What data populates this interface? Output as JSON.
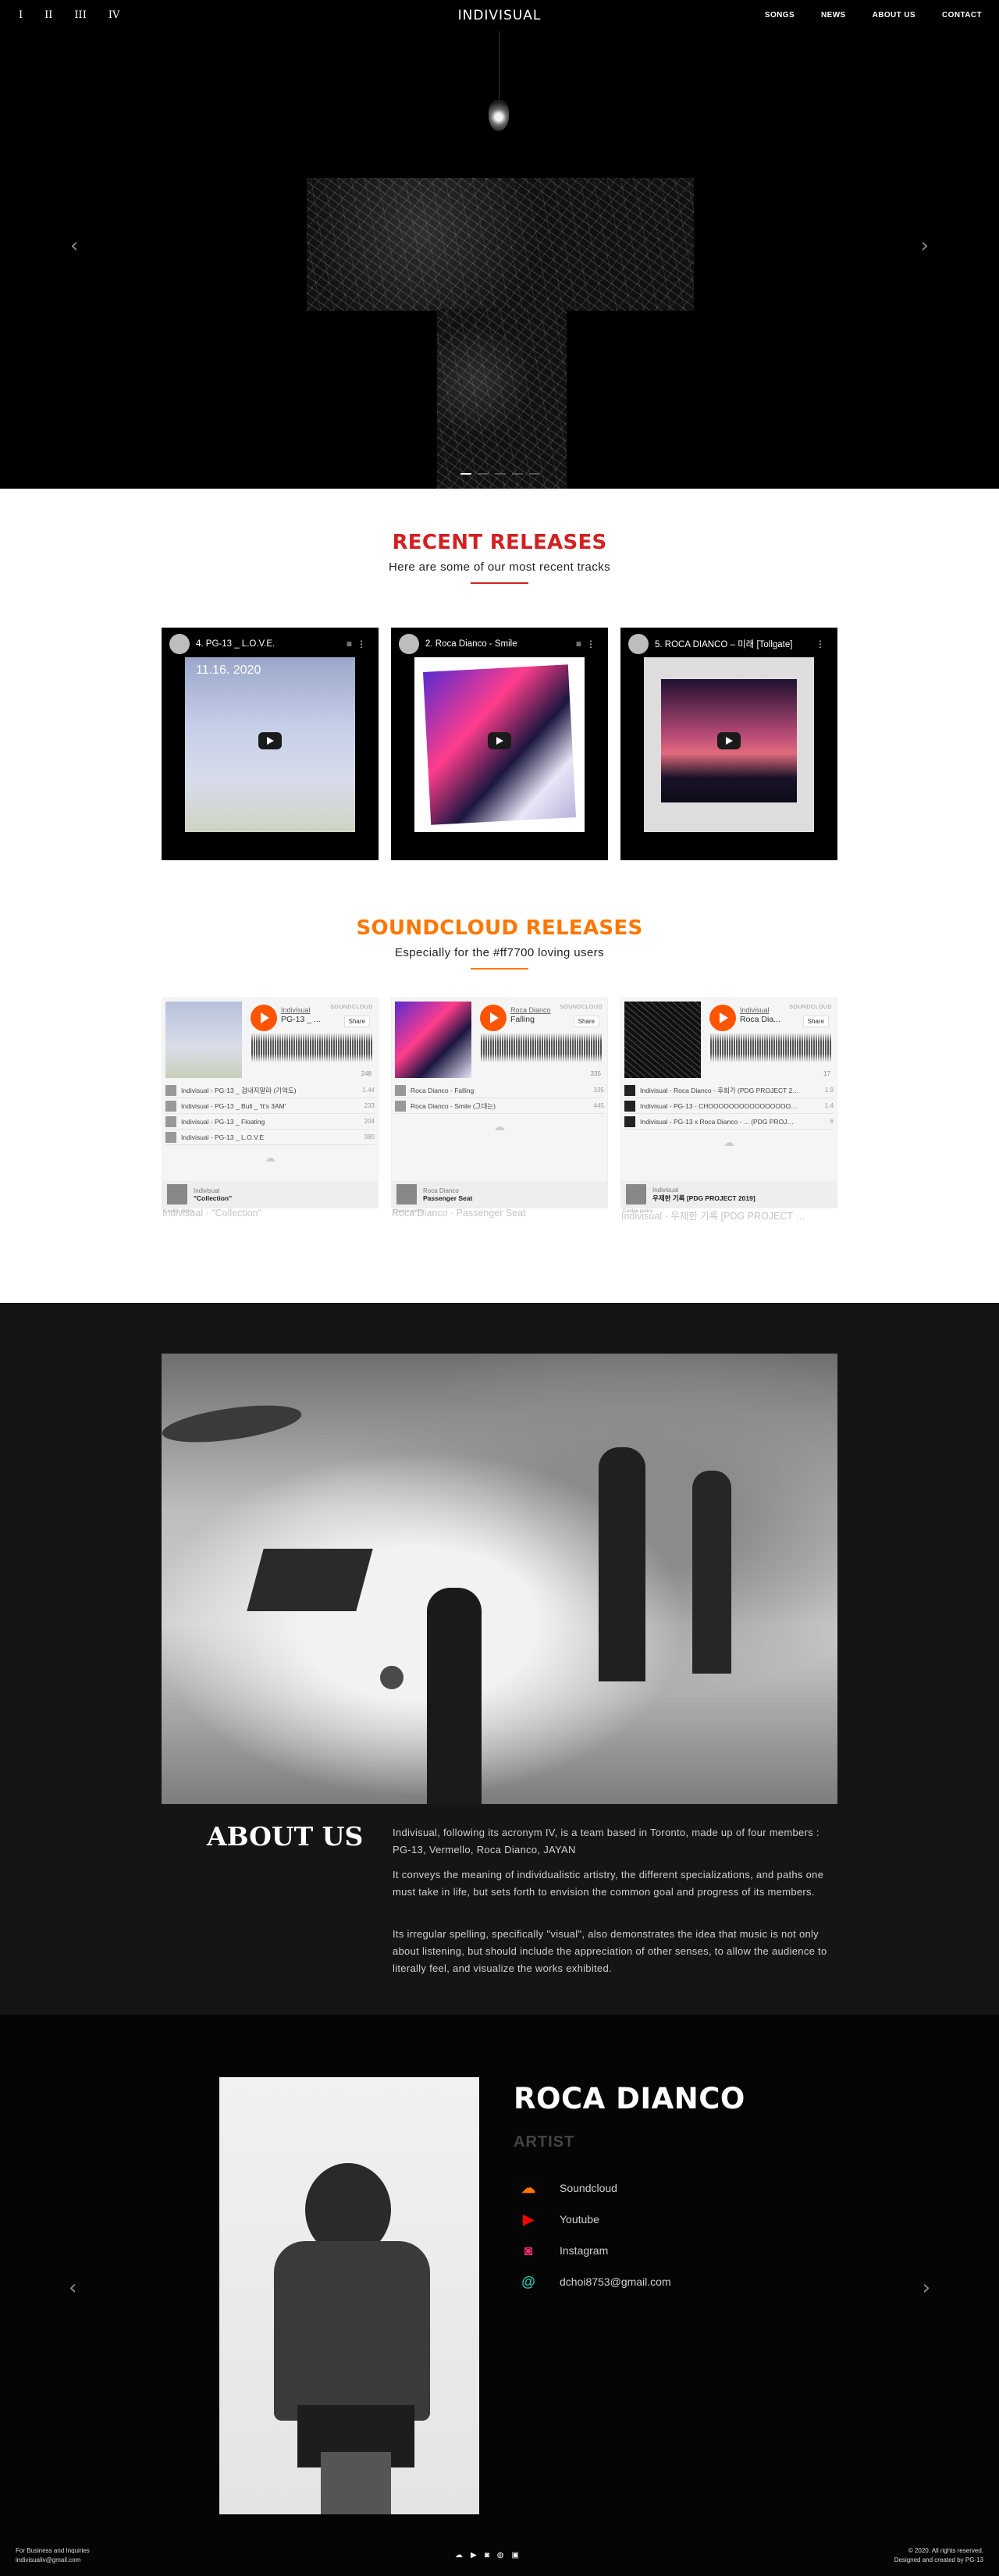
{
  "header": {
    "numerals": [
      "I",
      "II",
      "III",
      "IV"
    ],
    "brand": "INDIVISUAL",
    "nav": [
      "SONGS",
      "NEWS",
      "ABOUT US",
      "CONTACT"
    ]
  },
  "hero": {
    "prev": "‹",
    "next": "›"
  },
  "recent": {
    "title": "RECENT RELEASES",
    "subtitle": "Here are some of our most recent tracks",
    "accent": "#d42020",
    "videos": [
      {
        "title": "4. PG-13 _ L.O.V.E.",
        "date": "11.16. 2020"
      },
      {
        "title": "2. Roca Dianco - Smile"
      },
      {
        "title": "5. ROCA DIANCO – 미래 [Tollgate]"
      }
    ]
  },
  "soundcloud": {
    "title": "SOUNDCLOUD RELEASES",
    "subtitle": "Especially for the #ff7700 loving users",
    "accent": "#ff7700",
    "players": [
      {
        "artist": "Indivisual",
        "track": "PG-13 _ ...",
        "plays": "248",
        "tracks": [
          {
            "name": "Indivisual - PG-13 _ 겁내지말라 (기억도)",
            "plays": "1.44"
          },
          {
            "name": "Indivisual - PG-13 _ Bull _ 'It's 3AM'",
            "plays": "233"
          },
          {
            "name": "Indivisual - PG-13 _ Floating",
            "plays": "204"
          },
          {
            "name": "Indivisual - PG-13 _ L.O.V.E",
            "plays": "380"
          }
        ],
        "footer_artist": "Indivisual",
        "footer_album": "\"Collection\"",
        "caption": "Indivisual · \"Collection\""
      },
      {
        "artist": "Roca Dianco",
        "track": "Falling",
        "plays": "335",
        "tracks": [
          {
            "name": "Roca Dianco - Falling",
            "plays": "335"
          },
          {
            "name": "Roca Dianco - Smile (그대는)",
            "plays": "445"
          }
        ],
        "footer_artist": "Roca Dianco",
        "footer_album": "Passenger Seat",
        "caption": "Roca Dianco · Passenger Seat"
      },
      {
        "artist": "Indivisual",
        "track": "Roca Dia...",
        "plays": "17",
        "tracks": [
          {
            "name": "Indivisual - Roca Dianco - 후회가 (PDG PROJECT 2019)",
            "plays": "1.9"
          },
          {
            "name": "Indivisual - PG-13 - CHOOOOOOOOOOOOOOOOO…",
            "plays": "1.4"
          },
          {
            "name": "Indivisual - PG-13 x Roca Dianco - ... (PDG PROJ…",
            "plays": "6"
          }
        ],
        "footer_artist": "Indivisual",
        "footer_album": "우제한 기록 [PDG PROJECT 2019]",
        "caption": "Indivisual · 우제한 기록 [PDG PROJECT …"
      }
    ],
    "logo_text": "SOUNDCLOUD",
    "share": "Share",
    "cookie": "Cookie policy"
  },
  "about": {
    "heading": "ABOUT US",
    "paragraphs": [
      "Indivisual, following its acronym IV, is a team based in Toronto, made up of four members : PG-13, Vermello, Roca Dianco, JAYAN",
      "It conveys the meaning of individualistic artistry, the different specializations, and paths one must take in life, but sets forth to envision the common goal and progress of its members.",
      "Its irregular spelling, specifically \"visual\", also demonstrates the idea that music is not only about listening, but should include the appreciation of other senses, to allow the audience to literally feel, and visualize the works exhibited."
    ]
  },
  "artist": {
    "name": "ROCA DIANCO",
    "role": "ARTIST",
    "links": [
      {
        "label": "Soundcloud",
        "icon": "soundcloud-icon",
        "color": "#ff7700"
      },
      {
        "label": "Youtube",
        "icon": "youtube-icon",
        "color": "#ff0000"
      },
      {
        "label": "Instagram",
        "icon": "instagram-icon",
        "color": "#e1306c"
      },
      {
        "label": "dchoi8753@gmail.com",
        "icon": "at-sign-icon",
        "color": "#2ec4b6"
      }
    ],
    "prev": "‹",
    "next": "›"
  },
  "footer": {
    "left_line1": "For Business and Inquiries",
    "left_line2": "indivisualiv@gmail.com",
    "right_line1": "© 2020. All rights reserved.",
    "right_line2": "Designed and created by PG-13"
  }
}
